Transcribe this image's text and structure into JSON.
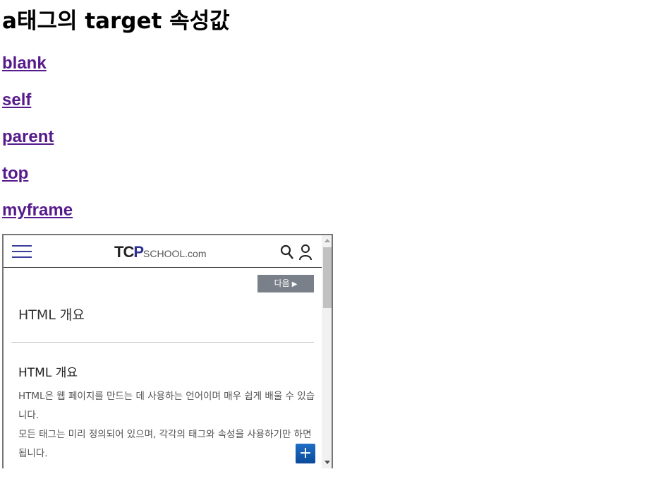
{
  "page": {
    "title": "a태그의 target 속성값",
    "links": [
      "blank",
      "self",
      "parent",
      "top",
      "myframe"
    ],
    "link_color": "#551a8b"
  },
  "iframe": {
    "header": {
      "logo_main_left": "TC",
      "logo_main_right": "P",
      "logo_sub": "SCHOOL.com",
      "menu_icon": "hamburger-icon",
      "search_icon": "search-icon",
      "user_icon": "user-icon",
      "accent": "#2e3092"
    },
    "next_button": "다음",
    "section_title": "HTML 개요",
    "subheading": "HTML 개요",
    "paragraph_line1": "HTML은 웹 페이지를 만드는 데 사용하는 언어이며 매우 쉽게 배울 수 있습니다.",
    "paragraph_line2": "모든 태그는 미리 정의되어 있으며, 각각의 태그와 속성을 사용하기만 하면 됩니다.",
    "fab_label": "+"
  }
}
